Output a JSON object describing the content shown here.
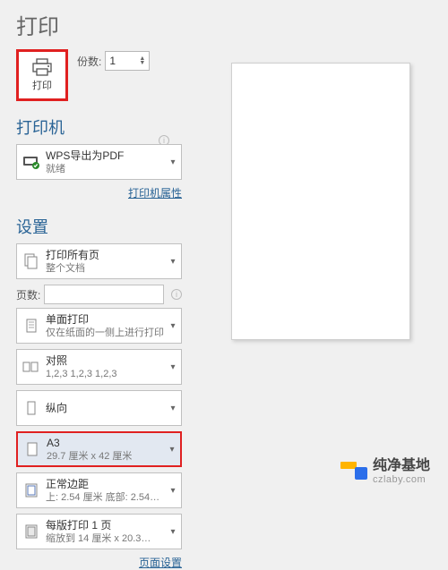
{
  "page_title": "打印",
  "copies": {
    "label": "份数:",
    "value": "1"
  },
  "print_button_label": "打印",
  "sections": {
    "printer_title": "打印机",
    "settings_title": "设置"
  },
  "printer": {
    "name": "WPS导出为PDF",
    "status": "就绪",
    "props_link": "打印机属性"
  },
  "print_range": {
    "title": "打印所有页",
    "sub": "整个文档"
  },
  "pages_label": "页数:",
  "duplex": {
    "title": "单面打印",
    "sub": "仅在纸面的一侧上进行打印"
  },
  "collate": {
    "title": "对照",
    "sub": "1,2,3   1,2,3   1,2,3"
  },
  "orientation": {
    "title": "纵向"
  },
  "paper": {
    "title": "A3",
    "sub": "29.7 厘米 x 42 厘米"
  },
  "margins": {
    "title": "正常边距",
    "sub": "上: 2.54 厘米 底部: 2.54…"
  },
  "scaling": {
    "title": "每版打印 1 页",
    "sub": "缩放到 14 厘米 x 20.3…"
  },
  "page_setup_link": "页面设置",
  "watermark": {
    "zh": "纯净基地",
    "url": "czlaby.com"
  }
}
